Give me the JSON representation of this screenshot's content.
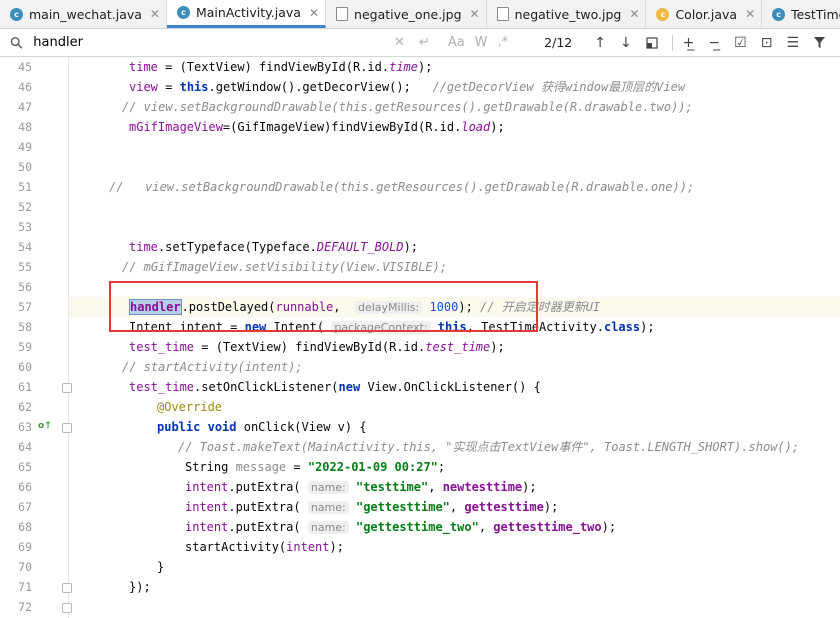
{
  "tabs": [
    {
      "label": "main_wechat.java",
      "type": "java"
    },
    {
      "label": "MainActivity.java",
      "type": "java",
      "active": true
    },
    {
      "label": "negative_one.jpg",
      "type": "jpg"
    },
    {
      "label": "negative_two.jpg",
      "type": "jpg"
    },
    {
      "label": "Color.java",
      "type": "color"
    },
    {
      "label": "TestTimeActivity.java",
      "type": "java"
    }
  ],
  "search": {
    "query": "handler",
    "match_count": "2/12",
    "opt_case": "Aa",
    "opt_word": "W",
    "opt_regex": ".*"
  },
  "gutter_lines": [
    "45",
    "46",
    "47",
    "48",
    "49",
    "50",
    "51",
    "52",
    "53",
    "54",
    "55",
    "56",
    "57",
    "58",
    "59",
    "60",
    "61",
    "62",
    "63",
    "64",
    "65",
    "66",
    "67",
    "68",
    "69",
    "70",
    "71",
    "72"
  ],
  "code": {
    "l45": {
      "a": "time",
      "b": " = (TextView) findViewById(R.id.",
      "c": "time",
      "d": ");"
    },
    "l46": {
      "a": "view",
      "b": " = ",
      "c": "this",
      "d": ".getWindow().getDecorView();   ",
      "e": "//getDecorView 获得window最顶层的View"
    },
    "l47": {
      "a": "// view.setBackgroundDrawable(this.getResources().getDrawable(R.drawable.two));"
    },
    "l48": {
      "a": "mGifImageView",
      "b": "=(GifImageView)findViewById(R.id.",
      "c": "load",
      "d": ");"
    },
    "l51": {
      "a": "//   view.setBackgroundDrawable(this.getResources().getDrawable(R.drawable.one));"
    },
    "l54": {
      "a": "time",
      "b": ".setTypeface(Typeface.",
      "c": "DEFAULT_BOLD",
      "d": ");"
    },
    "l55": {
      "a": "// mGifImageView.setVisibility(View.VISIBLE);"
    },
    "l57": {
      "a": "handler",
      "b": ".postDelayed(",
      "c": "runnable",
      "d": ",  ",
      "hint": "delayMillis:",
      "e": "1000",
      "f": "); ",
      "g": "// 开启定时器更新UI"
    },
    "l58": {
      "a": "Intent intent = ",
      "b": "new",
      "c": " Intent( ",
      "hint": "packageContext:",
      "d": "this",
      "e": ", TestTimeActivity.",
      "f": "class",
      "g": ");"
    },
    "l59": {
      "a": "test_time",
      "b": " = (TextView) findViewById(R.id.",
      "c": "test_time",
      "d": ");"
    },
    "l60": {
      "a": "// startActivity(intent);"
    },
    "l61": {
      "a": "test_time",
      "b": ".setOnClickListener(",
      "c": "new",
      "d": " View.OnClickListener() {"
    },
    "l62": {
      "a": "@Override"
    },
    "l63": {
      "a": "public",
      "b": " ",
      "c": "void",
      "d": " onClick(View v) {"
    },
    "l64": {
      "a": "// Toast.makeText(MainActivity.this, \"实现点击TextView事件\", Toast.LENGTH_SHORT).show();"
    },
    "l65": {
      "a": "String ",
      "b": "message",
      "c": " = ",
      "d": "\"2022-01-09 00:27\"",
      "e": ";"
    },
    "l66": {
      "a": "intent",
      "b": ".putExtra( ",
      "hint": "name:",
      "c": "\"testtime\"",
      "d": ", ",
      "e": "newtesttime",
      "f": ");"
    },
    "l67": {
      "a": "intent",
      "b": ".putExtra( ",
      "hint": "name:",
      "c": "\"gettesttime\"",
      "d": ", ",
      "e": "gettesttime",
      "f": ");"
    },
    "l68": {
      "a": "intent",
      "b": ".putExtra( ",
      "hint": "name:",
      "c": "\"gettesttime_two\"",
      "d": ", ",
      "e": "gettesttime_two",
      "f": ");"
    },
    "l69": {
      "a": "startActivity(",
      "b": "intent",
      "c": ");"
    },
    "l70": {
      "a": "}"
    },
    "l71": {
      "a": "});"
    }
  }
}
